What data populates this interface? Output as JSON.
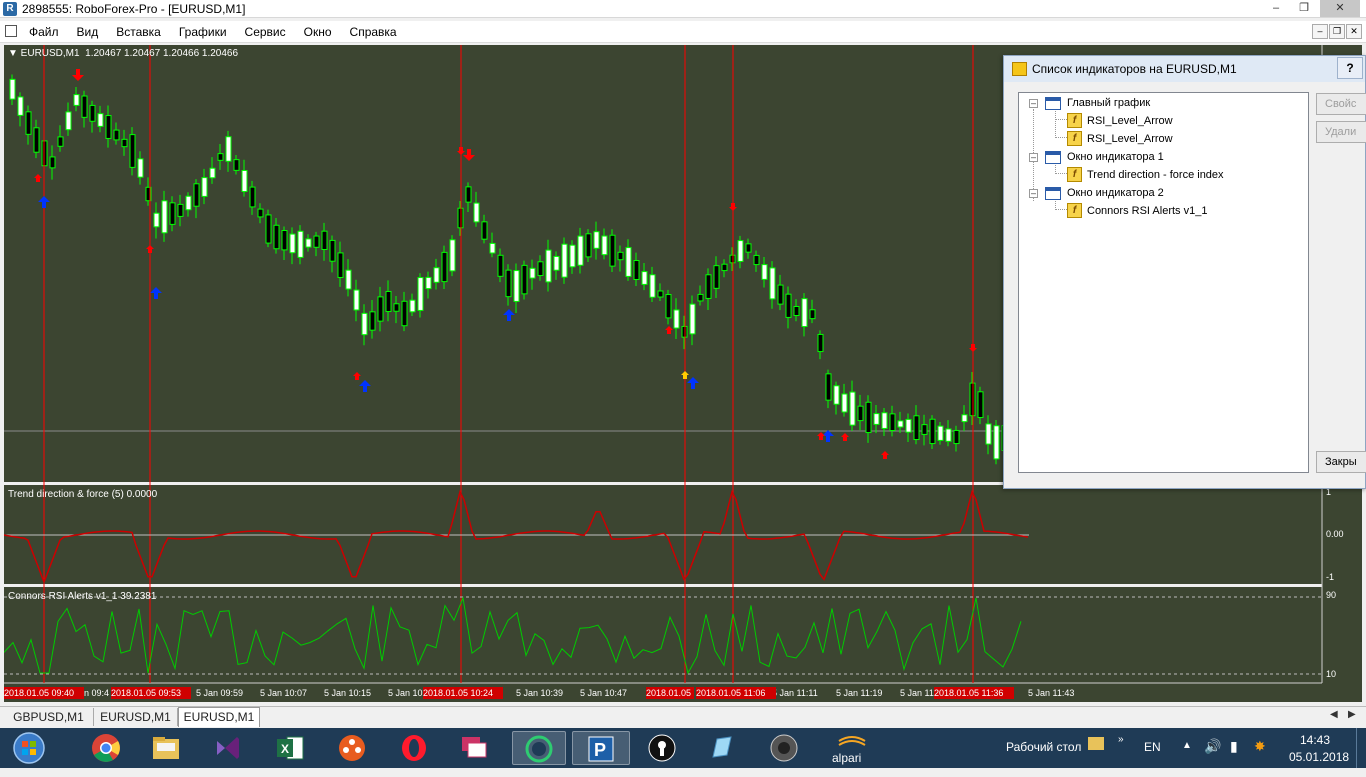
{
  "window": {
    "title": "2898555: RoboForex-Pro - [EURUSD,M1]",
    "controls": [
      "–",
      "❐",
      "✕"
    ]
  },
  "menu": {
    "items": [
      "Файл",
      "Вид",
      "Вставка",
      "Графики",
      "Сервис",
      "Окно",
      "Справка"
    ]
  },
  "chart": {
    "header": "▼ EURUSD,M1  1.20467 1.20467 1.20466 1.20466",
    "indicator1_label": "Trend direction & force (5) 0.0000",
    "indicator1_levels": [
      "1",
      "0.00",
      "-1"
    ],
    "indicator2_label": "Connors RSI Alerts v1_1 39.2381",
    "indicator2_levels": [
      "90",
      "10"
    ],
    "time_labels": [
      "5 Jan 09:59",
      "5 Jan 10:07",
      "5 Jan 10:15",
      "5 Jan 10:39",
      "5 Jan 10:47",
      "5 Jan 11:11",
      "5 Jan 11:19",
      "5 Jan 11:43"
    ],
    "time_labels_partial": [
      "n 09:4",
      "5 Jan 10",
      "5 Jan 11"
    ],
    "highlighted_times": [
      "2018.01.05 09:40",
      "2018.01.05 09:53",
      "2018.01.05 10:24",
      "2018.01.05 10:",
      "2018.01.05 11:06",
      "2018.01.05 11:36"
    ],
    "colors": {
      "background": "#3c4531",
      "bull": "#ffffff",
      "wick": "#00ff00",
      "vline": "#ff0000",
      "arrow_up": "#0033ff",
      "arrow_down": "#ff0000",
      "trend_line": "#cc0000",
      "rsi_line": "#00cc00"
    }
  },
  "tabs": {
    "items": [
      "GBPUSD,M1",
      "EURUSD,M1",
      "EURUSD,M1"
    ],
    "active_index": 2
  },
  "dialog": {
    "title": "Список индикаторов на EURUSD,M1",
    "help": "?",
    "tree": [
      {
        "label": "Главный график",
        "type": "window"
      },
      {
        "label": "RSI_Level_Arrow",
        "type": "indicator"
      },
      {
        "label": "RSI_Level_Arrow",
        "type": "indicator"
      },
      {
        "label": "Окно индикатора 1",
        "type": "window"
      },
      {
        "label": "Trend direction - force index",
        "type": "indicator"
      },
      {
        "label": "Окно индикатора 2",
        "type": "window"
      },
      {
        "label": "Connors RSI Alerts v1_1",
        "type": "indicator"
      }
    ],
    "buttons": {
      "properties": "Свойс",
      "delete": "Удали",
      "close": "Закры"
    }
  },
  "taskbar": {
    "apps": [
      "windows-start",
      "chrome",
      "file-explorer",
      "visual-studio",
      "excel",
      "media-player",
      "opera",
      "remote-desktop",
      "app-circle",
      "roboforex",
      "keyhole",
      "pen-tool",
      "speaker-app",
      "alpari"
    ],
    "alpari_label": "alpari",
    "desktop_label": "Рабочий стол",
    "lang": "EN",
    "time": "14:43",
    "date": "05.01.2018"
  }
}
